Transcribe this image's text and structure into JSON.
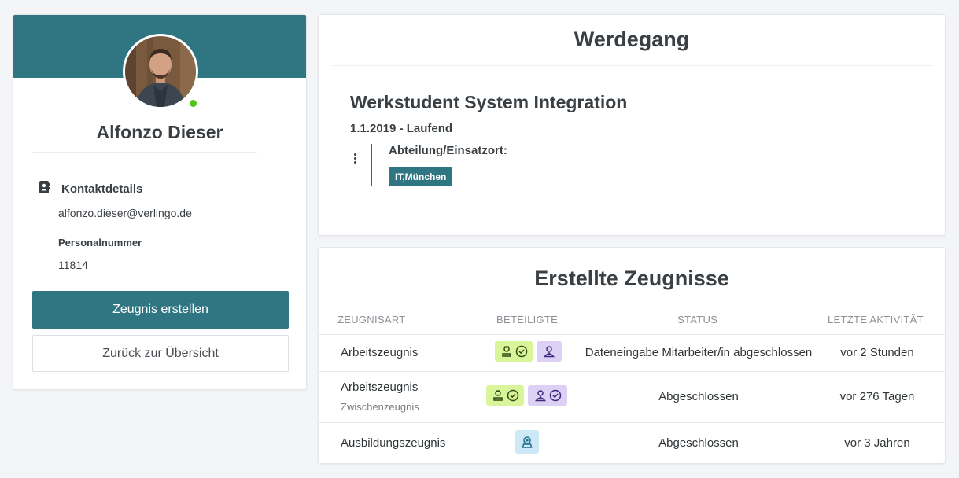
{
  "profile": {
    "name": "Alfonzo Dieser",
    "online": true,
    "contact_title": "Kontaktdetails",
    "email": "alfonzo.dieser@verlingo.de",
    "personalnummer_label": "Personalnummer",
    "personalnummer_value": "11814",
    "create_button": "Zeugnis erstellen",
    "back_button": "Zurück zur Übersicht"
  },
  "werdegang": {
    "title": "Werdegang",
    "entries": [
      {
        "job_title": "Werkstudent System Integration",
        "dates": "1.1.2019 - Laufend",
        "dept_label": "Abteilung/Einsatzort:",
        "dept_badge": "IT,München"
      }
    ]
  },
  "zeugnisse": {
    "title": "Erstellte Zeugnisse",
    "columns": [
      "ZEUGNISART",
      "BETEILIGTE",
      "STATUS",
      "LETZTE AKTIVITÄT"
    ],
    "rows": [
      {
        "type": "Arbeitszeugnis",
        "subtype": "",
        "participants": [
          "employee-check-icon",
          "manager-icon"
        ],
        "status": "Dateneingabe Mitarbeiter/in abgeschlossen",
        "last_activity": "vor 2 Stunden"
      },
      {
        "type": "Arbeitszeugnis",
        "subtype": "Zwischenzeugnis",
        "participants": [
          "employee-check-icon",
          "manager-check-icon"
        ],
        "status": "Abgeschlossen",
        "last_activity": "vor 276 Tagen"
      },
      {
        "type": "Ausbildungszeugnis",
        "subtype": "",
        "participants": [
          "trainer-icon"
        ],
        "status": "Abgeschlossen",
        "last_activity": "vor 3 Jahren"
      }
    ]
  },
  "colors": {
    "primary": "#2f7682",
    "online": "#53c41a",
    "employee_chip": "#d9f59a",
    "manager_chip": "#ddd0f5",
    "trainer_chip": "#cde9f6"
  }
}
